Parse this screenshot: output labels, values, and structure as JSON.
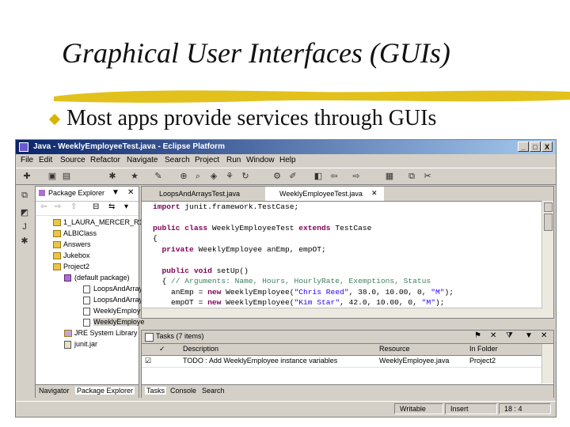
{
  "slide": {
    "title": "Graphical User Interfaces (GUIs)",
    "bullet": "Most apps provide services through GUIs",
    "accent": "#e2c11c"
  },
  "window": {
    "title": "Java - WeeklyEmployeeTest.java - Eclipse Platform",
    "min": "_",
    "max": "□",
    "close": "X"
  },
  "menu": [
    "File",
    "Edit",
    "Source",
    "Refactor",
    "Navigate",
    "Search",
    "Project",
    "Run",
    "Window",
    "Help"
  ],
  "explorer": {
    "title": "Package Explorer",
    "items": [
      {
        "label": "1_LAURA_MERCER_R1",
        "type": "project"
      },
      {
        "label": "ALBIClass",
        "type": "folder"
      },
      {
        "label": "Answers",
        "type": "folder"
      },
      {
        "label": "Jukebox",
        "type": "folder"
      },
      {
        "label": "Project2",
        "type": "project"
      },
      {
        "label": "(default package)",
        "type": "package"
      },
      {
        "label": "LoopsAndArray",
        "type": "file"
      },
      {
        "label": "LoopsAndArray",
        "type": "file"
      },
      {
        "label": "WeeklyEmploy",
        "type": "file"
      },
      {
        "label": "WeeklyEmploye",
        "type": "file"
      },
      {
        "label": "JRE System Library",
        "type": "lib"
      },
      {
        "label": "junit.jar",
        "type": "jar"
      }
    ],
    "tabs": [
      "Navigator",
      "Package Explorer"
    ]
  },
  "editor": {
    "tabs": [
      "LoopsAndArraysTest.java",
      "WeeklyEmployeeTest.java"
    ],
    "code": {
      "l1_kw": "import",
      "l1_rest": " junit.framework.TestCase;",
      "l2_kw1": "public class",
      "l2_mid": " WeeklyEmployeeTest ",
      "l2_kw2": "extends",
      "l2_rest": " TestCase",
      "l3": "{",
      "l4_kw": "private",
      "l4_rest": " WeeklyEmployee anEmp, empOT;",
      "l5_kw": "public void",
      "l5_rest": " setUp()",
      "l6_pre": "{ ",
      "l6_cmt": "// Arguments: Name, Hours, HourlyRate, Exemptions, Status",
      "l7_pre": "  anEmp = ",
      "l7_kw": "new",
      "l7_mid": " WeeklyEmployee(",
      "l7_str": "\"Chris Reed\"",
      "l7_mid2": ", 38.0, 10.00, 0, ",
      "l7_str2": "\"M\"",
      "l7_end": ");",
      "l8_pre": "  empOT = ",
      "l8_kw": "new",
      "l8_mid": " WeeklyEmployee(",
      "l8_str": "\"Kim Star\"",
      "l8_mid2": ", 42.0, 10.00, 0, ",
      "l8_str2": "\"M\"",
      "l8_end": ");"
    }
  },
  "tasks": {
    "title": "Tasks (7 items)",
    "columns": [
      "Description",
      "Resource",
      "In Folder"
    ],
    "rows": [
      {
        "description": "TODO : Add WeeklyEmployee instance variables",
        "resource": "WeeklyEmployee.java",
        "folder": "Project2"
      }
    ],
    "tabs": [
      "Tasks",
      "Console",
      "Search"
    ]
  },
  "status": {
    "writable": "Writable",
    "insert": "Insert",
    "position": "18 : 4"
  }
}
